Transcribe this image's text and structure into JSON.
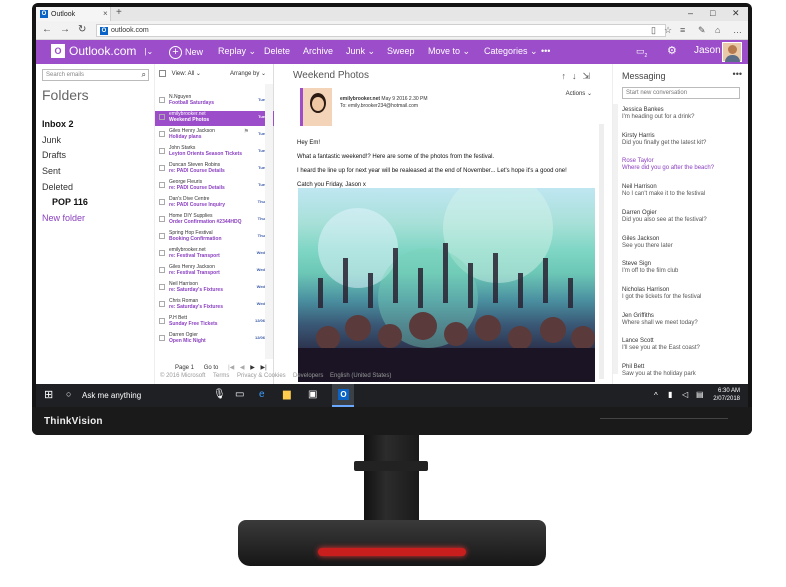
{
  "browser": {
    "tab_title": "Outlook",
    "url": "outlook.com",
    "new_tab": "+",
    "close_tab": "×",
    "minimize": "–",
    "maximize": "□",
    "close": "✕"
  },
  "outlook_header": {
    "logo": "Outlook.com",
    "commands": [
      "New",
      "Replay",
      "Delete",
      "Archive",
      "Junk",
      "Sweep",
      "Move to",
      "Categories",
      "•••"
    ],
    "user": "Jason",
    "chat_count": "2"
  },
  "folders": {
    "search_placeholder": "Search emails",
    "heading": "Folders",
    "items": [
      {
        "label": "Inbox  2"
      },
      {
        "label": "Junk"
      },
      {
        "label": "Drafts"
      },
      {
        "label": "Sent"
      },
      {
        "label": "Deleted"
      },
      {
        "label": "POP  116"
      },
      {
        "label": "New folder"
      }
    ]
  },
  "message_list": {
    "view": "View: All",
    "arrange": "Arrange by",
    "rows": [
      {
        "sender": "N.Nguyen",
        "subject": "Football Saturdays",
        "date": "Tue"
      },
      {
        "sender": "emilybrooker.net",
        "subject": "Weekend Photos",
        "date": "Tue"
      },
      {
        "sender": "Giles Henry Jackson",
        "subject": "Holiday plans",
        "date": "Tue"
      },
      {
        "sender": "John Starks",
        "subject": "Leyton Orients Season Tickets",
        "date": "Tue"
      },
      {
        "sender": "Duncan Steven Robins",
        "subject": "re: PADI Course Details",
        "date": "Tue"
      },
      {
        "sender": "George Fleuris",
        "subject": "re: PADI Course Details",
        "date": "Tue"
      },
      {
        "sender": "Dan's Dive Centre",
        "subject": "re: PADI Course Inquiry",
        "date": "Thu"
      },
      {
        "sender": "Home DIY Supplies",
        "subject": "Order Confirmation #2344HDQ",
        "date": "Thu"
      },
      {
        "sender": "Spring Hop Festival",
        "subject": "Booking Confirmation",
        "date": "Thu"
      },
      {
        "sender": "emilybrooker.net",
        "subject": "re: Festival Transport",
        "date": "Wed"
      },
      {
        "sender": "Giles Henry Jackson",
        "subject": "re: Festival Transport",
        "date": "Wed"
      },
      {
        "sender": "Neil Harrison",
        "subject": "re: Saturday's Fixtures",
        "date": "Wed"
      },
      {
        "sender": "Chris Roman",
        "subject": "re: Saturday's Fixtures",
        "date": "Wed"
      },
      {
        "sender": "P.H Bett",
        "subject": "Sunday Free Tickets",
        "date": "12/06"
      },
      {
        "sender": "Darren Ogier",
        "subject": "Open Mic Night",
        "date": "12/06"
      }
    ],
    "pager_page": "Page 1",
    "pager_goto": "Go to"
  },
  "reading": {
    "title": "Weekend Photos",
    "actions": "Actions",
    "from": "emilybrooker.net",
    "sent": "May 9 2016 2.30 PM",
    "to": "To: emily.brooker234@hotmail.com",
    "greeting": "Hey Em!",
    "line1": "What a fantastic weekend!? Here are some of the photos from the festival.",
    "line2": "I heard the line up for next year will be realeased at the end of November... Let's hope it's a good one!",
    "signoff": "Catch you Friday, Jason x"
  },
  "footer": {
    "items": [
      "© 2016 Microsoft",
      "Terms",
      "Privacy & Cookies",
      "Developers",
      "English (United States)"
    ]
  },
  "messaging": {
    "title": "Messaging",
    "new_conv": "Start new conversation",
    "contacts": [
      {
        "name": "Jessica Bankes",
        "preview": "I'm heading out for a drink?"
      },
      {
        "name": "Kirsty Harris",
        "preview": "Did you finally get the latest kit?"
      },
      {
        "name": "Rose Taylor",
        "preview": "Where did you go after the beach?"
      },
      {
        "name": "Neil Harrison",
        "preview": "No I can't make it to the festival"
      },
      {
        "name": "Darren Ogier",
        "preview": "Did you also see at the festival?"
      },
      {
        "name": "Giles Jackson",
        "preview": "See you there later"
      },
      {
        "name": "Steve Sign",
        "preview": "I'm off to the film club"
      },
      {
        "name": "Nicholas Harrison",
        "preview": "I got the tickets for the festival"
      },
      {
        "name": "Jen Griffiths",
        "preview": "Where shall we meet today?"
      },
      {
        "name": "Lance Scott",
        "preview": "I'll see you at the East coast?"
      },
      {
        "name": "Phil Bett",
        "preview": "Saw you at the holiday park"
      }
    ]
  },
  "taskbar": {
    "search": "Ask me anything",
    "time": "6:30 AM",
    "date": "2/07/2018"
  },
  "monitor": {
    "brand": "ThinkVision"
  }
}
